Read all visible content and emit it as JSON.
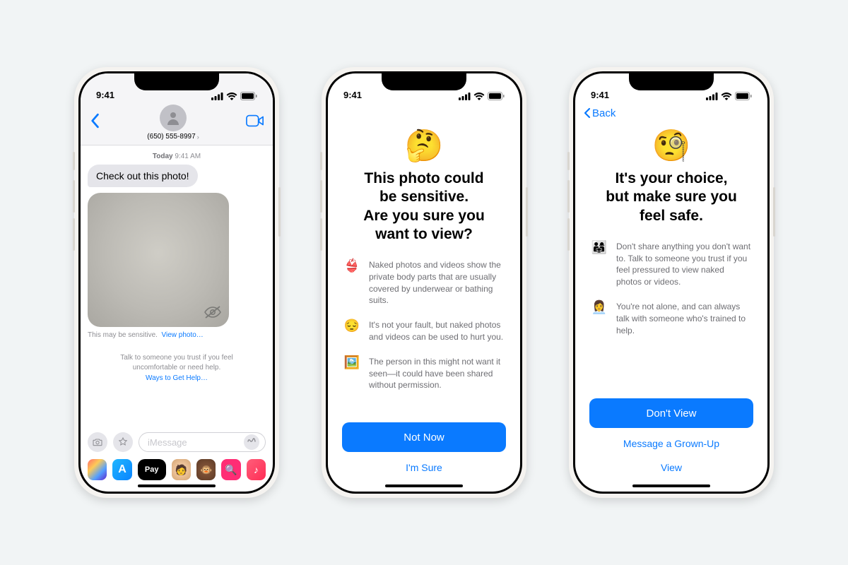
{
  "status": {
    "time": "9:41"
  },
  "phone1": {
    "contact": "(650) 555-8997",
    "timestamp_day": "Today",
    "timestamp_time": "9:41 AM",
    "incoming_msg": "Check out this photo!",
    "sensitive_prefix": "This may be sensitive.",
    "view_photo": "View photo…",
    "help_text": "Talk to someone you trust if you feel uncomfortable or need help.",
    "help_link": "Ways to Get Help…",
    "compose_placeholder": "iMessage",
    "applepay_label": " Pay"
  },
  "phone2": {
    "emoji": "🤔",
    "title_l1": "This photo could",
    "title_l2": "be sensitive.",
    "title_l3": "Are you sure you",
    "title_l4": "want to view?",
    "points": [
      {
        "emoji": "👙",
        "text": "Naked photos and videos show the private body parts that are usually covered by underwear or bathing suits."
      },
      {
        "emoji": "😔",
        "text": "It's not your fault, but naked photos and videos can be used to hurt you."
      },
      {
        "emoji": "🖼️",
        "text": "The person in this might not want it seen—it could have been shared without permission."
      }
    ],
    "primary": "Not Now",
    "secondary": "I'm Sure"
  },
  "phone3": {
    "back": "Back",
    "emoji": "🧐",
    "title_l1": "It's your choice,",
    "title_l2": "but make sure you",
    "title_l3": "feel safe.",
    "points": [
      {
        "emoji": "👨‍👩‍👧",
        "text": "Don't share anything you don't want to. Talk to someone you trust if you feel pressured to view naked photos or videos."
      },
      {
        "emoji": "👩‍💼",
        "text": "You're not alone, and can always talk with someone who's trained to help."
      }
    ],
    "primary": "Don't View",
    "link1": "Message a Grown-Up",
    "link2": "View"
  }
}
